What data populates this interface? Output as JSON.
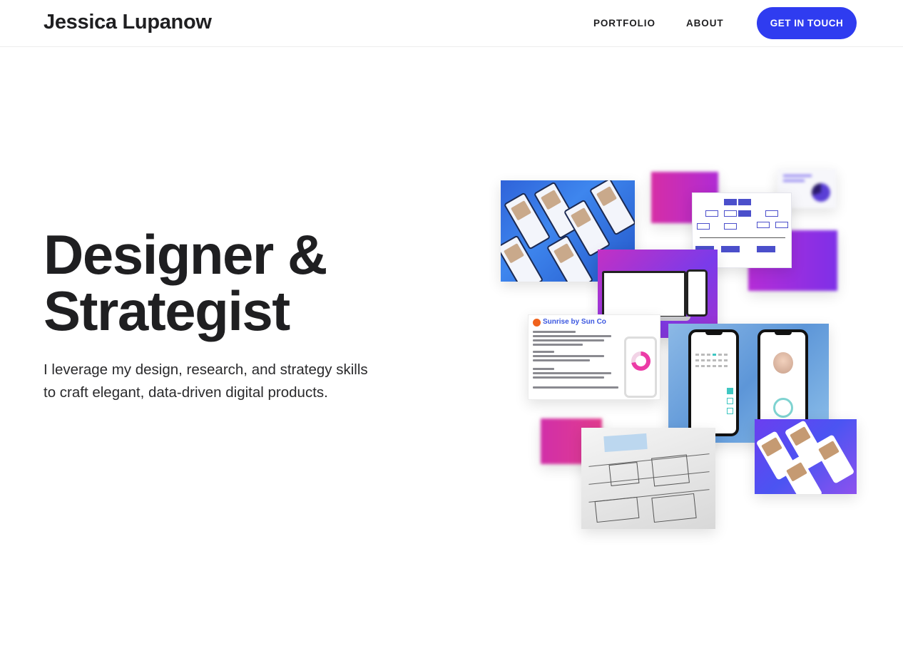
{
  "header": {
    "logo": "Jessica Lupanow",
    "nav": {
      "portfolio": "PORTFOLIO",
      "about": "ABOUT",
      "cta": "GET IN TOUCH"
    },
    "cta_color": "#2f3cf0"
  },
  "hero": {
    "title_line1": "Designer &",
    "title_line2": "Strategist",
    "subtitle": "I leverage my design, research, and strategy skills to craft elegant, data-driven digital products."
  },
  "collage": {
    "doc_title": "Sunrise by Sun Co"
  }
}
